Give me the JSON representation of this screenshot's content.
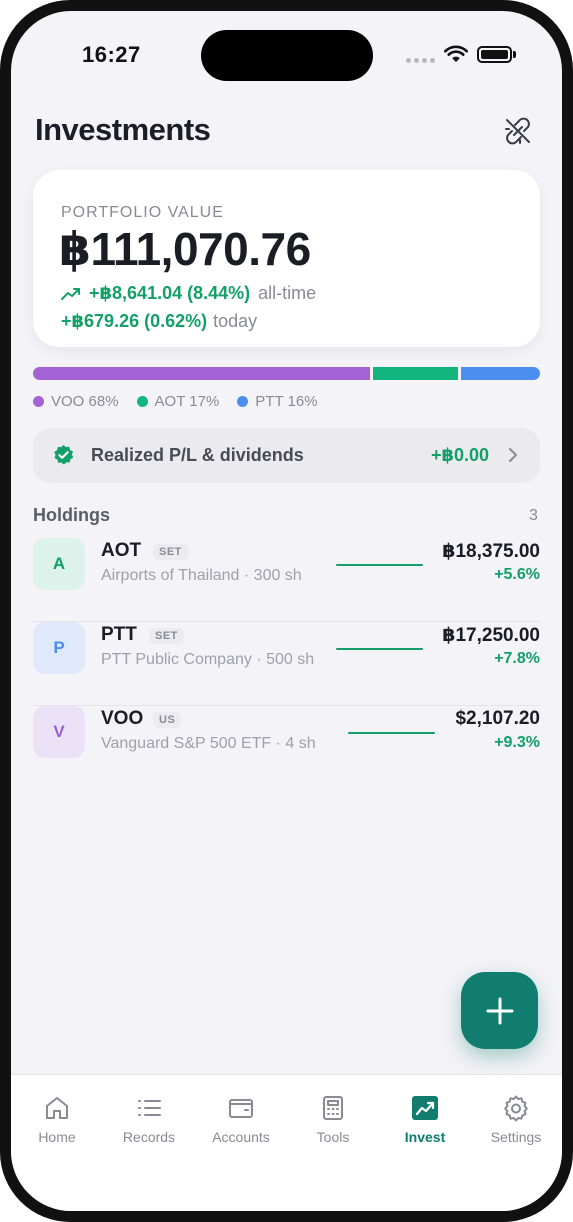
{
  "status": {
    "time": "16:27"
  },
  "header": {
    "title": "Investments"
  },
  "portfolio": {
    "label": "PORTFOLIO VALUE",
    "value": "฿111,070.76",
    "alltime_change": "+฿8,641.04 (8.44%)",
    "alltime_label": "all-time",
    "today_change": "+฿679.26 (0.62%)",
    "today_label": "today"
  },
  "allocation": [
    {
      "label": "VOO 68%",
      "fraction": 0.68,
      "color": "#a363d4"
    },
    {
      "label": "AOT 17%",
      "fraction": 0.17,
      "color": "#13b57f"
    },
    {
      "label": "PTT 16%",
      "fraction": 0.16,
      "color": "#4a8ef0"
    }
  ],
  "realized": {
    "label": "Realized P/L & dividends",
    "value": "+฿0.00"
  },
  "holdings": {
    "title": "Holdings",
    "count": "3",
    "items": [
      {
        "initial": "A",
        "symbol": "AOT",
        "market": "SET",
        "name": "Airports of Thailand · 300 sh",
        "value": "฿18,375.00",
        "change": "+5.6%",
        "avatar_bg": "#dcf2ea",
        "avatar_fg": "#13a068"
      },
      {
        "initial": "P",
        "symbol": "PTT",
        "market": "SET",
        "name": "PTT Public Company · 500 sh",
        "value": "฿17,250.00",
        "change": "+7.8%",
        "avatar_bg": "#dfe9fb",
        "avatar_fg": "#4a8ef0"
      },
      {
        "initial": "V",
        "symbol": "VOO",
        "market": "US",
        "name": "Vanguard S&P 500 ETF · 4 sh",
        "value": "$2,107.20",
        "change": "+9.3%",
        "avatar_bg": "#ece2f7",
        "avatar_fg": "#9a5fd0"
      }
    ]
  },
  "tabs": [
    {
      "label": "Home",
      "icon": "home-icon"
    },
    {
      "label": "Records",
      "icon": "list-icon"
    },
    {
      "label": "Accounts",
      "icon": "wallet-icon"
    },
    {
      "label": "Tools",
      "icon": "calculator-icon"
    },
    {
      "label": "Invest",
      "icon": "chart-icon",
      "active": true
    },
    {
      "label": "Settings",
      "icon": "gear-icon"
    }
  ],
  "colors": {
    "accent": "#107d6f",
    "positive": "#13a068"
  }
}
